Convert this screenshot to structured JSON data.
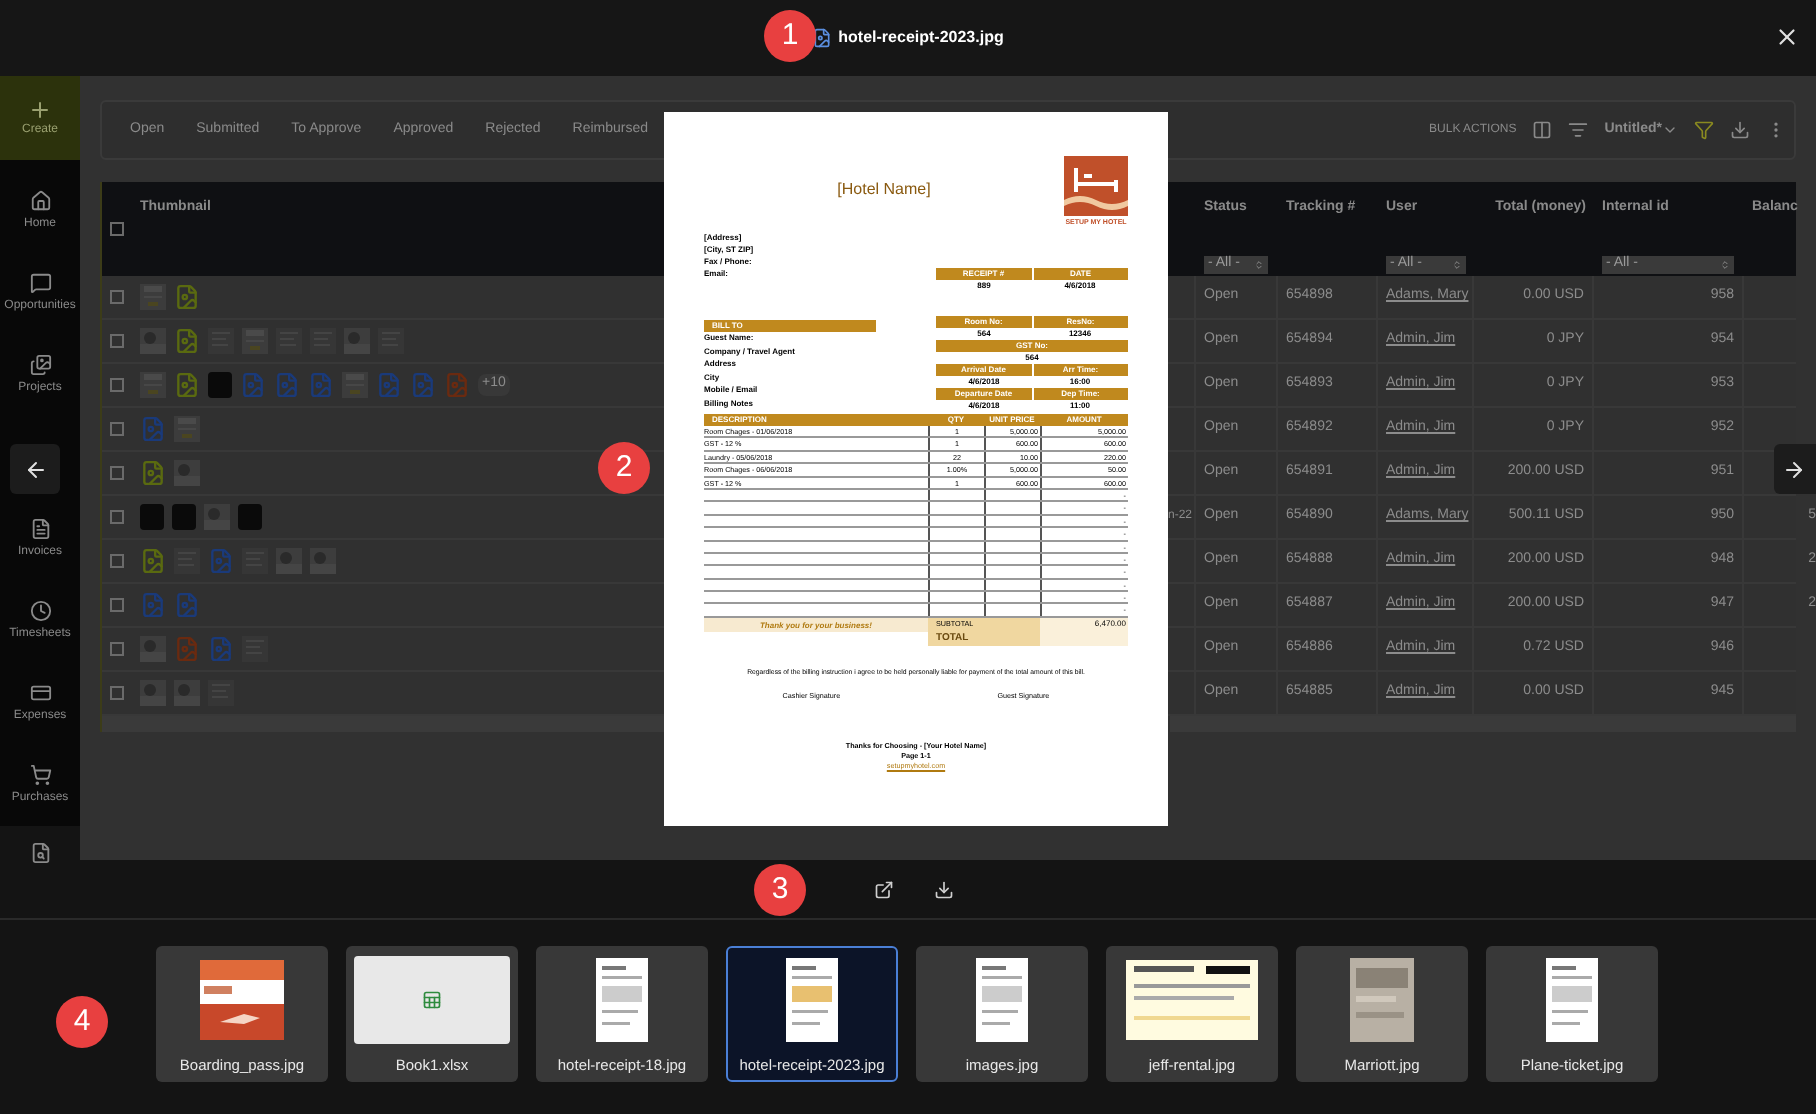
{
  "viewer": {
    "title": "hotel-receipt-2023.jpg"
  },
  "markers": [
    {
      "label": "1"
    },
    {
      "label": "2"
    },
    {
      "label": "3"
    },
    {
      "label": "4"
    }
  ],
  "app": {
    "create": "Create",
    "nav": [
      {
        "label": "Home"
      },
      {
        "label": "Opportunities"
      },
      {
        "label": "Projects"
      },
      {
        "label": "Invoices"
      },
      {
        "label": "Timesheets"
      },
      {
        "label": "Expenses"
      },
      {
        "label": "Purchases"
      }
    ],
    "tabs": [
      "Open",
      "Submitted",
      "To Approve",
      "Approved",
      "Rejected",
      "Reimbursed"
    ],
    "bulk_actions": "BULK ACTIONS",
    "view": "Untitled*"
  },
  "table": {
    "columns": [
      "Thumbnail",
      "Status",
      "Tracking #",
      "User",
      "Total (money)",
      "Internal id",
      "Balanc"
    ],
    "select_all_checked": false,
    "filters": [
      "- All -",
      "- All -",
      "- All -"
    ],
    "rows": [
      {
        "checked": false,
        "status": "Open",
        "tracking": "654898",
        "user": "Adams, Mary",
        "total": "0.00 USD",
        "internal_id": "958"
      },
      {
        "checked": false,
        "status": "Open",
        "tracking": "654894",
        "user": "Admin, Jim",
        "total": "0 JPY",
        "internal_id": "954"
      },
      {
        "checked": false,
        "more": "+10",
        "status": "Open",
        "tracking": "654893",
        "user": "Admin, Jim",
        "total": "0 JPY",
        "internal_id": "953"
      },
      {
        "checked": false,
        "status": "Open",
        "tracking": "654892",
        "user": "Admin, Jim",
        "total": "0 JPY",
        "internal_id": "952"
      },
      {
        "checked": false,
        "status": "Open",
        "tracking": "654891",
        "user": "Admin, Jim",
        "total": "200.00 USD",
        "internal_id": "951"
      },
      {
        "checked": false,
        "date_fragment": "n-22",
        "status": "Open",
        "tracking": "654890",
        "user": "Adams, Mary",
        "total": "500.11 USD",
        "internal_id": "950",
        "balance": "5"
      },
      {
        "checked": false,
        "status": "Open",
        "tracking": "654888",
        "user": "Admin, Jim",
        "total": "200.00 USD",
        "internal_id": "948",
        "balance": "2"
      },
      {
        "checked": false,
        "status": "Open",
        "tracking": "654887",
        "user": "Admin, Jim",
        "total": "200.00 USD",
        "internal_id": "947",
        "balance": "2"
      },
      {
        "checked": false,
        "status": "Open",
        "tracking": "654886",
        "user": "Admin, Jim",
        "total": "0.72 USD",
        "internal_id": "946"
      },
      {
        "checked": false,
        "status": "Open",
        "tracking": "654885",
        "user": "Admin, Jim",
        "total": "0.00 USD",
        "internal_id": "945"
      }
    ]
  },
  "receipt": {
    "hotel_name": "[Hotel Name]",
    "logo_text": "SETUP MY HOTEL",
    "address_lines": [
      "[Address]",
      "[City, ST ZIP]",
      "Fax / Phone:",
      "Email:"
    ],
    "bill_to": "BILL TO",
    "bill_labels": [
      "Guest Name:",
      "Company / Travel Agent",
      "Address",
      "City",
      "Mobile / Email",
      "Billing Notes"
    ],
    "blocks": [
      {
        "headers": [
          "RECEIPT #",
          "DATE"
        ],
        "values": [
          "889",
          "4/6/2018"
        ]
      },
      {
        "headers": [
          "Room No:",
          "ResNo:"
        ],
        "values": [
          "564",
          "12346"
        ]
      },
      {
        "headers": [
          "GST No:"
        ],
        "values": [
          "564"
        ]
      },
      {
        "headers": [
          "Arrival Date",
          "Arr Time:"
        ],
        "values": [
          "4/6/2018",
          "16:00"
        ]
      },
      {
        "headers": [
          "Departure Date",
          "Dep Time:"
        ],
        "values": [
          "4/6/2018",
          "11:00"
        ]
      }
    ],
    "item_columns": [
      "DESCRIPTION",
      "QTY",
      "UNIT PRICE",
      "AMOUNT"
    ],
    "items": [
      [
        "Room Chages - 01/06/2018",
        "1",
        "5,000.00",
        "5,000.00"
      ],
      [
        "GST - 12 %",
        "1",
        "600.00",
        "600.00"
      ],
      [
        "Laundry - 05/06/2018",
        "22",
        "10.00",
        "220.00"
      ],
      [
        "Room Chages - 06/06/2018",
        "1.00%",
        "5,000.00",
        "50.00"
      ],
      [
        "GST - 12 %",
        "1",
        "600.00",
        "600.00"
      ]
    ],
    "blank_rows": [
      "-",
      "-",
      "-",
      "-",
      "-",
      "-",
      "-",
      "-",
      "-",
      "-"
    ],
    "thanks": "Thank you for your business!",
    "subtotal_label": "SUBTOTAL",
    "subtotal": "6,470.00",
    "total_label": "TOTAL",
    "agreement": "Regardless of the billing instruction i agree to be held personally liable for payment of the total amount of this bill.",
    "signatures": [
      "Cashier Signature",
      "Guest Signature"
    ],
    "footer": [
      "Thanks for Choosing - [Your Hotel Name]",
      "Page 1-1"
    ],
    "website": "setupmyhotel.com"
  },
  "strip": [
    {
      "name": "Boarding_pass.jpg",
      "kind": "boarding",
      "selected": false
    },
    {
      "name": "Book1.xlsx",
      "kind": "sheet",
      "selected": false
    },
    {
      "name": "hotel-receipt-18.jpg",
      "kind": "doc",
      "selected": false
    },
    {
      "name": "hotel-receipt-2023.jpg",
      "kind": "receipt",
      "selected": true
    },
    {
      "name": "images.jpg",
      "kind": "doc",
      "selected": false
    },
    {
      "name": "jeff-rental.jpg",
      "kind": "wide",
      "selected": false
    },
    {
      "name": "Marriott.jpg",
      "selected": false
    },
    {
      "name": "Plane-ticket.jpg",
      "kind": "doc",
      "selected": false
    }
  ]
}
